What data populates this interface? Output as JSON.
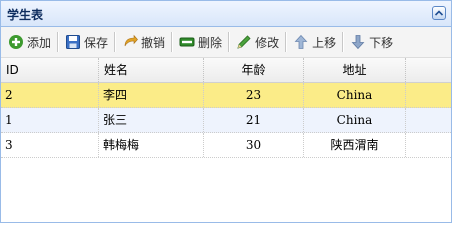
{
  "panel": {
    "title": "学生表"
  },
  "toolbar": {
    "buttons": [
      {
        "label": "添加",
        "icon": "add-icon"
      },
      {
        "label": "保存",
        "icon": "save-icon"
      },
      {
        "label": "撤销",
        "icon": "undo-icon"
      },
      {
        "label": "删除",
        "icon": "delete-icon"
      },
      {
        "label": "修改",
        "icon": "edit-icon"
      },
      {
        "label": "上移",
        "icon": "arrow-up-icon"
      },
      {
        "label": "下移",
        "icon": "arrow-down-icon"
      }
    ]
  },
  "grid": {
    "columns": [
      "ID",
      "姓名",
      "年龄",
      "地址"
    ],
    "rows": [
      {
        "id": "2",
        "name": "李四",
        "age": "23",
        "address": "China",
        "state": "selected"
      },
      {
        "id": "1",
        "name": "张三",
        "age": "21",
        "address": "China",
        "state": "alternate"
      },
      {
        "id": "3",
        "name": "韩梅梅",
        "age": "30",
        "address": "陕西渭南",
        "state": "normal"
      }
    ]
  },
  "colors": {
    "selected_row": "#fbec88",
    "alternate_row": "#eef3fd",
    "panel_border": "#99bbe8",
    "title_text": "#0e2d5f"
  }
}
